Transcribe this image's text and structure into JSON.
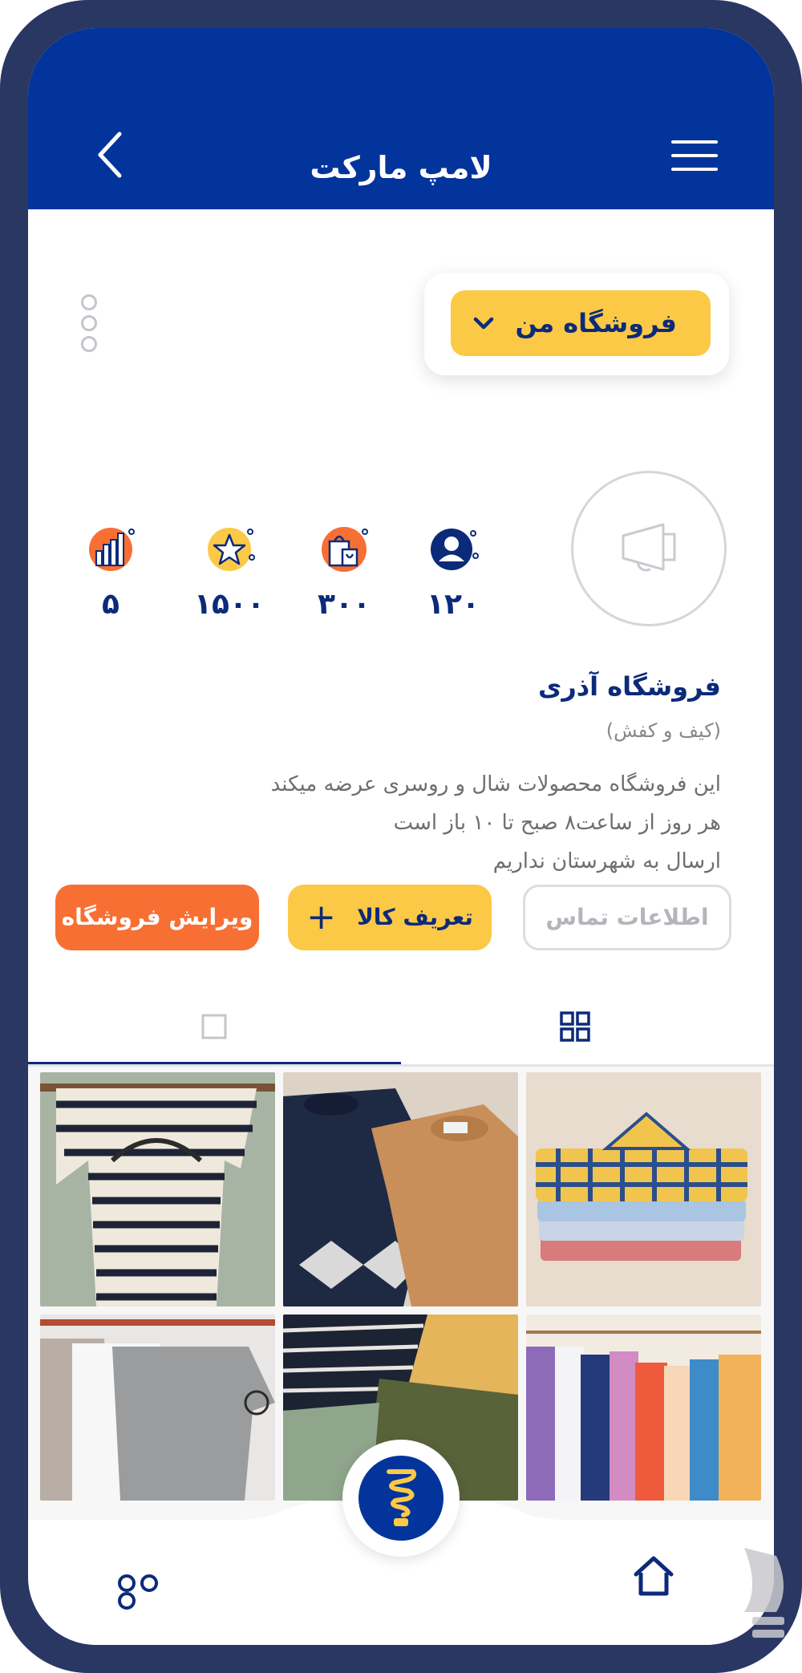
{
  "header": {
    "title": "لامپ مارکت"
  },
  "store_selector": {
    "label": "فروشگاه من"
  },
  "stats": [
    {
      "icon": "user-icon",
      "value": "۱۲۰"
    },
    {
      "icon": "shopping-bags-icon",
      "value": "۳۰۰"
    },
    {
      "icon": "star-icon",
      "value": "۱۵۰۰"
    },
    {
      "icon": "bar-chart-icon",
      "value": "۵"
    }
  ],
  "shop": {
    "name": "فروشگاه آذری",
    "category": "(کیف و کفش)",
    "description": [
      "این فروشگاه محصولات شال و روسری عرضه میکند",
      "هر روز از ساعت۸ صبح تا ۱۰ باز است",
      "ارسال به شهرستان نداریم"
    ]
  },
  "actions": {
    "contact": "اطلاعات تماس",
    "define_product": "تعریف کالا",
    "edit_store": "ویرایش فروشگاه"
  },
  "tabs": [
    {
      "icon": "grid-view-icon",
      "active": true
    },
    {
      "icon": "single-view-icon",
      "active": false
    }
  ],
  "products": [
    {
      "icon": "folded-plaid-shirts-image"
    },
    {
      "icon": "knit-sweaters-image"
    },
    {
      "icon": "striped-tshirt-image"
    },
    {
      "icon": "clothing-rack-image"
    },
    {
      "icon": "striped-shirt-and-pants-image"
    },
    {
      "icon": "tshirts-on-hangers-image"
    }
  ],
  "colors": {
    "primary": "#02349c",
    "navy": "#0b2a7a",
    "yellow": "#fbc946",
    "orange": "#f86f34",
    "frame": "#2a3763"
  }
}
